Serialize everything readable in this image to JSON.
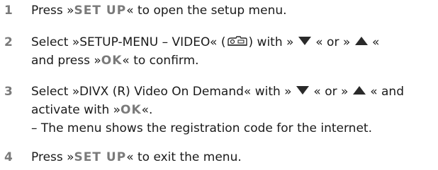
{
  "steps": [
    {
      "number": "1",
      "line1": {
        "pre": "Press »",
        "key": "SET UP",
        "post": "« to open the setup menu."
      }
    },
    {
      "number": "2",
      "line1": {
        "pre": "Select »SETUP-MENU – VIDEO« (",
        "icon": "video-camera-icon",
        "mid1": ") with »",
        "arrow1": "down",
        "mid2": "« or »",
        "arrow2": "up",
        "post": "«"
      },
      "line2": {
        "pre": "and press »",
        "key": "OK",
        "post": "« to confirm."
      }
    },
    {
      "number": "3",
      "line1": {
        "pre": "Select »DIVX (R) Video On Demand« with »",
        "arrow1": "down",
        "mid": "« or »",
        "arrow2": "up",
        "post": "« and"
      },
      "line2": {
        "pre": "activate with »",
        "key": "OK",
        "post": "«."
      },
      "line3": "– The menu shows the registration code for the internet."
    },
    {
      "number": "4",
      "line1": {
        "pre": "Press »",
        "key": "SET UP",
        "post": "« to exit the menu."
      }
    }
  ],
  "colors": {
    "text": "#1a1a1a",
    "accent_grey": "#7a7a7a",
    "arrow": "#2a2a2a"
  }
}
